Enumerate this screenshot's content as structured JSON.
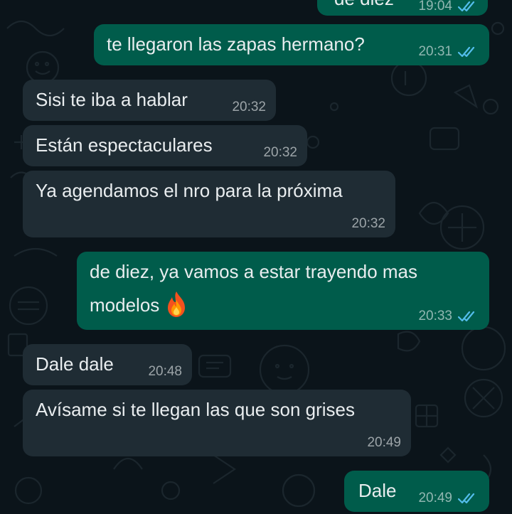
{
  "messages": [
    {
      "id": "m0",
      "dir": "out",
      "text": "de diez",
      "time": "19:04",
      "status": "read"
    },
    {
      "id": "m1",
      "dir": "out",
      "text": "te llegaron las zapas hermano?",
      "time": "20:31",
      "status": "read"
    },
    {
      "id": "m2",
      "dir": "in",
      "text": "Sisi te iba a hablar",
      "time": "20:32"
    },
    {
      "id": "m3",
      "dir": "in",
      "text": "Están espectaculares",
      "time": "20:32"
    },
    {
      "id": "m4",
      "dir": "in",
      "text": "Ya agendamos el nro para la próxima",
      "time": "20:32"
    },
    {
      "id": "m5",
      "dir": "out",
      "line1": "de diez, ya vamos a estar trayendo mas",
      "line2": "modelos",
      "emoji": "fire-emoji",
      "time": "20:33",
      "status": "read"
    },
    {
      "id": "m6",
      "dir": "in",
      "text": "Dale dale",
      "time": "20:48"
    },
    {
      "id": "m7",
      "dir": "in",
      "text": "Avísame si te llegan las que son grises",
      "time": "20:49"
    },
    {
      "id": "m8",
      "dir": "out",
      "text": "Dale",
      "time": "20:49",
      "status": "read"
    }
  ],
  "colors": {
    "background": "#0b141a",
    "incoming_bubble": "#1f2c34",
    "outgoing_bubble": "#005c4b",
    "read_ticks": "#53bdeb"
  },
  "icons": {
    "read_receipt": "double-check-icon",
    "fire": "fire-emoji"
  }
}
